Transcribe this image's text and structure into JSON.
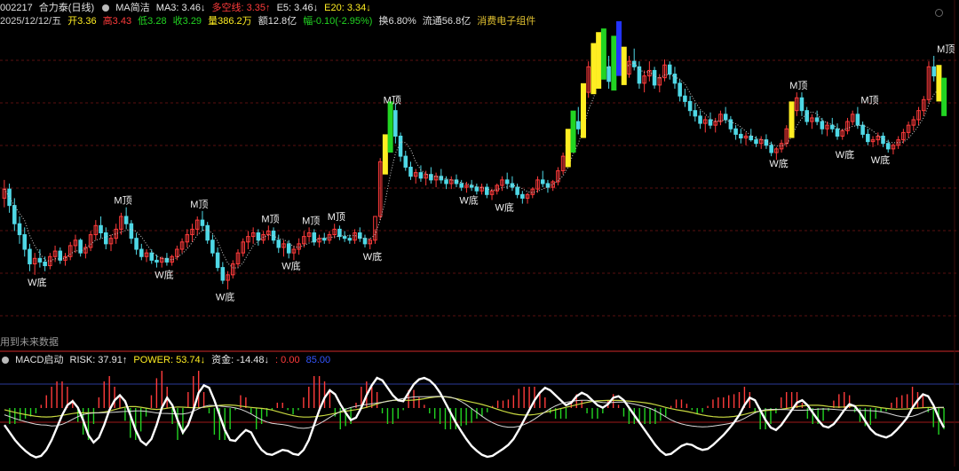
{
  "header": {
    "code": "002217",
    "name": "合力泰(日线)",
    "ma_label": "MA简洁",
    "ma3": "MA3: 3.46↓",
    "duokong": "多空线: 3.35↑",
    "e5": "E5: 3.46↓",
    "e20": "E20: 3.34↓",
    "date": "2025/12/12/五",
    "open": "开3.36",
    "high": "高3.43",
    "low": "低3.28",
    "close": "收3.29",
    "volume": "量386.2万",
    "amount": "额12.8亿",
    "change": "幅-0.10(-2.95%)",
    "turnover": "换6.80%",
    "float_cap": "流通56.8亿",
    "sector": "消费电子组件"
  },
  "colors": {
    "up": "#ff3b3b",
    "down": "#4fd8e6",
    "green_bar": "#22d422",
    "yellow_bar": "#ffee22",
    "blue_bar": "#2233ff",
    "sector": "#e0c030",
    "panel_border": "#8b1a1a"
  },
  "future_note": "用到未来数据",
  "indicator_header": {
    "name": "MACD启动",
    "risk": "RISK: 37.91↑",
    "power": "POWER: 53.74↓",
    "fund": "资金: -14.48↓",
    "v1": ": 0.00",
    "v2": "85.00"
  },
  "chart_data": {
    "type": "candlestick",
    "ylim": [
      2.0,
      3.75
    ],
    "candles": [
      [
        2.8,
        2.9,
        2.75,
        2.85
      ],
      [
        2.85,
        2.88,
        2.72,
        2.76
      ],
      [
        2.76,
        2.8,
        2.62,
        2.66
      ],
      [
        2.66,
        2.7,
        2.55,
        2.6
      ],
      [
        2.6,
        2.64,
        2.48,
        2.52
      ],
      [
        2.52,
        2.55,
        2.4,
        2.44
      ],
      [
        2.44,
        2.5,
        2.38,
        2.47
      ],
      [
        2.47,
        2.52,
        2.42,
        2.45
      ],
      [
        2.45,
        2.48,
        2.4,
        2.43
      ],
      [
        2.43,
        2.5,
        2.41,
        2.48
      ],
      [
        2.48,
        2.54,
        2.45,
        2.51
      ],
      [
        2.51,
        2.53,
        2.44,
        2.46
      ],
      [
        2.46,
        2.5,
        2.43,
        2.48
      ],
      [
        2.48,
        2.56,
        2.46,
        2.54
      ],
      [
        2.54,
        2.6,
        2.5,
        2.57
      ],
      [
        2.57,
        2.58,
        2.48,
        2.5
      ],
      [
        2.5,
        2.55,
        2.47,
        2.53
      ],
      [
        2.53,
        2.62,
        2.51,
        2.6
      ],
      [
        2.6,
        2.68,
        2.57,
        2.65
      ],
      [
        2.65,
        2.7,
        2.58,
        2.61
      ],
      [
        2.61,
        2.64,
        2.52,
        2.55
      ],
      [
        2.55,
        2.6,
        2.51,
        2.58
      ],
      [
        2.58,
        2.66,
        2.55,
        2.63
      ],
      [
        2.63,
        2.72,
        2.6,
        2.7
      ],
      [
        2.7,
        2.75,
        2.63,
        2.66
      ],
      [
        2.66,
        2.68,
        2.55,
        2.58
      ],
      [
        2.58,
        2.61,
        2.49,
        2.52
      ],
      [
        2.52,
        2.55,
        2.46,
        2.48
      ],
      [
        2.48,
        2.52,
        2.45,
        2.5
      ],
      [
        2.5,
        2.52,
        2.44,
        2.46
      ],
      [
        2.46,
        2.49,
        2.42,
        2.45
      ],
      [
        2.45,
        2.48,
        2.42,
        2.47
      ],
      [
        2.47,
        2.5,
        2.43,
        2.45
      ],
      [
        2.45,
        2.49,
        2.43,
        2.48
      ],
      [
        2.48,
        2.54,
        2.46,
        2.52
      ],
      [
        2.52,
        2.58,
        2.5,
        2.56
      ],
      [
        2.56,
        2.63,
        2.53,
        2.6
      ],
      [
        2.6,
        2.66,
        2.56,
        2.63
      ],
      [
        2.63,
        2.7,
        2.6,
        2.68
      ],
      [
        2.68,
        2.73,
        2.62,
        2.65
      ],
      [
        2.65,
        2.67,
        2.55,
        2.57
      ],
      [
        2.57,
        2.6,
        2.48,
        2.5
      ],
      [
        2.5,
        2.53,
        2.4,
        2.42
      ],
      [
        2.42,
        2.45,
        2.33,
        2.35
      ],
      [
        2.35,
        2.4,
        2.3,
        2.38
      ],
      [
        2.38,
        2.46,
        2.36,
        2.44
      ],
      [
        2.44,
        2.52,
        2.42,
        2.5
      ],
      [
        2.5,
        2.58,
        2.48,
        2.56
      ],
      [
        2.56,
        2.62,
        2.52,
        2.59
      ],
      [
        2.59,
        2.64,
        2.55,
        2.61
      ],
      [
        2.61,
        2.63,
        2.54,
        2.57
      ],
      [
        2.57,
        2.62,
        2.55,
        2.6
      ],
      [
        2.6,
        2.65,
        2.57,
        2.62
      ],
      [
        2.62,
        2.64,
        2.55,
        2.57
      ],
      [
        2.57,
        2.6,
        2.5,
        2.53
      ],
      [
        2.53,
        2.57,
        2.48,
        2.55
      ],
      [
        2.55,
        2.57,
        2.47,
        2.5
      ],
      [
        2.5,
        2.54,
        2.46,
        2.52
      ],
      [
        2.52,
        2.58,
        2.49,
        2.55
      ],
      [
        2.55,
        2.62,
        2.53,
        2.59
      ],
      [
        2.59,
        2.64,
        2.56,
        2.61
      ],
      [
        2.61,
        2.63,
        2.54,
        2.56
      ],
      [
        2.56,
        2.6,
        2.53,
        2.58
      ],
      [
        2.58,
        2.61,
        2.55,
        2.57
      ],
      [
        2.57,
        2.62,
        2.55,
        2.6
      ],
      [
        2.6,
        2.66,
        2.58,
        2.63
      ],
      [
        2.63,
        2.65,
        2.57,
        2.59
      ],
      [
        2.59,
        2.62,
        2.56,
        2.58
      ],
      [
        2.58,
        2.6,
        2.55,
        2.57
      ],
      [
        2.57,
        2.63,
        2.55,
        2.61
      ],
      [
        2.61,
        2.64,
        2.56,
        2.58
      ],
      [
        2.58,
        2.6,
        2.53,
        2.55
      ],
      [
        2.55,
        2.58,
        2.52,
        2.57
      ],
      [
        2.57,
        2.63,
        2.55,
        2.7
      ],
      [
        2.7,
        3.02,
        2.68,
        3.0
      ],
      [
        3.0,
        3.12,
        2.96,
        3.1
      ],
      [
        3.1,
        3.3,
        3.08,
        3.28
      ],
      [
        3.28,
        3.32,
        3.1,
        3.14
      ],
      [
        3.14,
        3.16,
        3.0,
        3.03
      ],
      [
        3.03,
        3.06,
        2.95,
        2.97
      ],
      [
        2.97,
        3.0,
        2.9,
        2.92
      ],
      [
        2.92,
        2.96,
        2.88,
        2.94
      ],
      [
        2.94,
        2.98,
        2.89,
        2.91
      ],
      [
        2.91,
        2.95,
        2.87,
        2.93
      ],
      [
        2.93,
        2.97,
        2.88,
        2.9
      ],
      [
        2.9,
        2.94,
        2.86,
        2.92
      ],
      [
        2.92,
        2.96,
        2.88,
        2.9
      ],
      [
        2.9,
        2.92,
        2.85,
        2.88
      ],
      [
        2.88,
        2.92,
        2.85,
        2.9
      ],
      [
        2.9,
        2.93,
        2.86,
        2.88
      ],
      [
        2.88,
        2.9,
        2.84,
        2.86
      ],
      [
        2.86,
        2.89,
        2.83,
        2.87
      ],
      [
        2.87,
        2.9,
        2.84,
        2.86
      ],
      [
        2.86,
        2.88,
        2.82,
        2.84
      ],
      [
        2.84,
        2.88,
        2.82,
        2.86
      ],
      [
        2.86,
        2.88,
        2.8,
        2.82
      ],
      [
        2.82,
        2.85,
        2.79,
        2.84
      ],
      [
        2.84,
        2.88,
        2.82,
        2.87
      ],
      [
        2.87,
        2.92,
        2.84,
        2.9
      ],
      [
        2.9,
        2.94,
        2.85,
        2.88
      ],
      [
        2.88,
        2.92,
        2.84,
        2.86
      ],
      [
        2.86,
        2.88,
        2.8,
        2.82
      ],
      [
        2.82,
        2.84,
        2.77,
        2.8
      ],
      [
        2.8,
        2.83,
        2.77,
        2.82
      ],
      [
        2.82,
        2.86,
        2.8,
        2.85
      ],
      [
        2.85,
        2.92,
        2.83,
        2.9
      ],
      [
        2.9,
        2.95,
        2.86,
        2.88
      ],
      [
        2.88,
        2.9,
        2.83,
        2.86
      ],
      [
        2.86,
        2.9,
        2.84,
        2.89
      ],
      [
        2.89,
        2.97,
        2.87,
        2.95
      ],
      [
        2.95,
        3.05,
        2.93,
        3.03
      ],
      [
        3.03,
        3.15,
        3.0,
        3.12
      ],
      [
        3.12,
        3.25,
        3.08,
        3.22
      ],
      [
        3.22,
        3.3,
        3.15,
        3.18
      ],
      [
        3.18,
        3.4,
        3.16,
        3.38
      ],
      [
        3.38,
        3.55,
        3.35,
        3.52
      ],
      [
        3.52,
        3.62,
        3.4,
        3.45
      ],
      [
        3.45,
        3.68,
        3.43,
        3.66
      ],
      [
        3.66,
        3.7,
        3.48,
        3.52
      ],
      [
        3.52,
        3.58,
        3.4,
        3.44
      ],
      [
        3.44,
        3.66,
        3.42,
        3.62
      ],
      [
        3.62,
        3.74,
        3.5,
        3.55
      ],
      [
        3.55,
        3.6,
        3.45,
        3.48
      ],
      [
        3.48,
        3.58,
        3.46,
        3.55
      ],
      [
        3.55,
        3.62,
        3.5,
        3.52
      ],
      [
        3.52,
        3.55,
        3.4,
        3.43
      ],
      [
        3.43,
        3.5,
        3.38,
        3.47
      ],
      [
        3.47,
        3.55,
        3.44,
        3.5
      ],
      [
        3.5,
        3.52,
        3.4,
        3.42
      ],
      [
        3.42,
        3.48,
        3.38,
        3.46
      ],
      [
        3.46,
        3.56,
        3.44,
        3.53
      ],
      [
        3.53,
        3.55,
        3.45,
        3.48
      ],
      [
        3.48,
        3.52,
        3.4,
        3.43
      ],
      [
        3.43,
        3.45,
        3.33,
        3.36
      ],
      [
        3.36,
        3.4,
        3.3,
        3.33
      ],
      [
        3.33,
        3.36,
        3.25,
        3.28
      ],
      [
        3.28,
        3.32,
        3.22,
        3.25
      ],
      [
        3.25,
        3.28,
        3.18,
        3.21
      ],
      [
        3.21,
        3.25,
        3.16,
        3.23
      ],
      [
        3.23,
        3.27,
        3.18,
        3.2
      ],
      [
        3.2,
        3.24,
        3.16,
        3.22
      ],
      [
        3.22,
        3.28,
        3.2,
        3.26
      ],
      [
        3.26,
        3.3,
        3.21,
        3.23
      ],
      [
        3.23,
        3.25,
        3.16,
        3.18
      ],
      [
        3.18,
        3.2,
        3.12,
        3.15
      ],
      [
        3.15,
        3.18,
        3.1,
        3.13
      ],
      [
        3.13,
        3.16,
        3.09,
        3.14
      ],
      [
        3.14,
        3.18,
        3.11,
        3.12
      ],
      [
        3.12,
        3.14,
        3.08,
        3.1
      ],
      [
        3.1,
        3.14,
        3.07,
        3.12
      ],
      [
        3.12,
        3.15,
        3.07,
        3.09
      ],
      [
        3.09,
        3.11,
        3.03,
        3.05
      ],
      [
        3.05,
        3.08,
        3.01,
        3.07
      ],
      [
        3.07,
        3.12,
        3.05,
        3.1
      ],
      [
        3.1,
        3.2,
        3.08,
        3.18
      ],
      [
        3.18,
        3.3,
        3.16,
        3.28
      ],
      [
        3.28,
        3.38,
        3.25,
        3.35
      ],
      [
        3.35,
        3.38,
        3.25,
        3.28
      ],
      [
        3.28,
        3.3,
        3.2,
        3.22
      ],
      [
        3.22,
        3.26,
        3.18,
        3.24
      ],
      [
        3.24,
        3.28,
        3.2,
        3.22
      ],
      [
        3.22,
        3.24,
        3.15,
        3.18
      ],
      [
        3.18,
        3.22,
        3.14,
        3.2
      ],
      [
        3.2,
        3.24,
        3.16,
        3.18
      ],
      [
        3.18,
        3.21,
        3.12,
        3.14
      ],
      [
        3.14,
        3.18,
        3.12,
        3.17
      ],
      [
        3.17,
        3.24,
        3.15,
        3.22
      ],
      [
        3.22,
        3.28,
        3.2,
        3.26
      ],
      [
        3.26,
        3.3,
        3.18,
        3.2
      ],
      [
        3.2,
        3.22,
        3.13,
        3.15
      ],
      [
        3.15,
        3.18,
        3.09,
        3.11
      ],
      [
        3.11,
        3.14,
        3.08,
        3.12
      ],
      [
        3.12,
        3.16,
        3.09,
        3.14
      ],
      [
        3.14,
        3.16,
        3.08,
        3.1
      ],
      [
        3.1,
        3.12,
        3.05,
        3.07
      ],
      [
        3.07,
        3.1,
        3.04,
        3.09
      ],
      [
        3.09,
        3.14,
        3.07,
        3.12
      ],
      [
        3.12,
        3.18,
        3.1,
        3.16
      ],
      [
        3.16,
        3.22,
        3.13,
        3.2
      ],
      [
        3.2,
        3.25,
        3.17,
        3.23
      ],
      [
        3.23,
        3.3,
        3.2,
        3.28
      ],
      [
        3.28,
        3.36,
        3.25,
        3.34
      ],
      [
        3.34,
        3.55,
        3.32,
        3.52
      ],
      [
        3.52,
        3.58,
        3.44,
        3.47
      ],
      [
        3.47,
        3.5,
        3.36,
        3.39
      ],
      [
        3.39,
        3.43,
        3.28,
        3.29
      ]
    ],
    "annotations": [
      {
        "text": "W底",
        "index": 6,
        "price": 2.38,
        "pos": "below"
      },
      {
        "text": "M顶",
        "index": 23,
        "price": 2.75,
        "pos": "above"
      },
      {
        "text": "W底",
        "index": 31,
        "price": 2.42,
        "pos": "below"
      },
      {
        "text": "M顶",
        "index": 38,
        "price": 2.73,
        "pos": "above"
      },
      {
        "text": "W底",
        "index": 43,
        "price": 2.3,
        "pos": "below"
      },
      {
        "text": "M顶",
        "index": 52,
        "price": 2.65,
        "pos": "above"
      },
      {
        "text": "W底",
        "index": 56,
        "price": 2.47,
        "pos": "below"
      },
      {
        "text": "M顶",
        "index": 60,
        "price": 2.64,
        "pos": "above"
      },
      {
        "text": "M顶",
        "index": 65,
        "price": 2.66,
        "pos": "above"
      },
      {
        "text": "W底",
        "index": 72,
        "price": 2.52,
        "pos": "below"
      },
      {
        "text": "M顶",
        "index": 76,
        "price": 3.3,
        "pos": "above"
      },
      {
        "text": "W底",
        "index": 91,
        "price": 2.83,
        "pos": "below"
      },
      {
        "text": "W底",
        "index": 98,
        "price": 2.79,
        "pos": "below"
      },
      {
        "text": "M顶",
        "index": 156,
        "price": 3.38,
        "pos": "above"
      },
      {
        "text": "W底",
        "index": 152,
        "price": 3.03,
        "pos": "below"
      },
      {
        "text": "M顶",
        "index": 170,
        "price": 3.3,
        "pos": "above"
      },
      {
        "text": "W底",
        "index": 165,
        "price": 3.08,
        "pos": "below"
      },
      {
        "text": "W底",
        "index": 172,
        "price": 3.05,
        "pos": "below"
      },
      {
        "text": "M顶",
        "index": 185,
        "price": 3.58,
        "pos": "above"
      }
    ],
    "signal_bars": [
      {
        "index": 75,
        "color": "yellow"
      },
      {
        "index": 76,
        "color": "green"
      },
      {
        "index": 111,
        "color": "yellow"
      },
      {
        "index": 112,
        "color": "green"
      },
      {
        "index": 114,
        "color": "yellow"
      },
      {
        "index": 116,
        "color": "yellow"
      },
      {
        "index": 117,
        "color": "yellow"
      },
      {
        "index": 118,
        "color": "green"
      },
      {
        "index": 120,
        "color": "green"
      },
      {
        "index": 121,
        "color": "blue"
      },
      {
        "index": 122,
        "color": "yellow"
      },
      {
        "index": 155,
        "color": "yellow"
      },
      {
        "index": 184,
        "color": "yellow"
      },
      {
        "index": 185,
        "color": "green"
      }
    ],
    "indicator": {
      "ylim": [
        -100,
        100
      ],
      "white": [
        -20,
        -35,
        -50,
        -62,
        -72,
        -80,
        -85,
        -82,
        -70,
        -50,
        -25,
        0,
        20,
        28,
        15,
        -10,
        -40,
        -55,
        -45,
        -20,
        10,
        30,
        40,
        28,
        0,
        -30,
        -52,
        -60,
        -48,
        -20,
        15,
        35,
        20,
        -10,
        -35,
        -20,
        10,
        45,
        60,
        55,
        30,
        0,
        -30,
        -50,
        -52,
        -40,
        -30,
        -35,
        -55,
        -70,
        -78,
        -80,
        -75,
        -70,
        -72,
        -78,
        -80,
        -70,
        -50,
        -20,
        10,
        35,
        50,
        42,
        22,
        5,
        -10,
        -5,
        15,
        40,
        60,
        75,
        70,
        55,
        40,
        30,
        28,
        45,
        62,
        72,
        75,
        70,
        60,
        45,
        25,
        5,
        -15,
        -32,
        -48,
        -62,
        -72,
        -80,
        -84,
        -82,
        -75,
        -68,
        -60,
        -48,
        -30,
        -10,
        10,
        30,
        45,
        55,
        50,
        40,
        30,
        20,
        25,
        38,
        45,
        40,
        30,
        20,
        15,
        22,
        35,
        38,
        30,
        15,
        0,
        -15,
        -30,
        -45,
        -60,
        -72,
        -80,
        -78,
        -70,
        -62,
        -58,
        -60,
        -66,
        -70,
        -68,
        -60,
        -50,
        -40,
        -28,
        -15,
        0,
        20,
        35,
        30,
        10,
        -10,
        -25,
        -30,
        -20,
        -5,
        10,
        25,
        30,
        20,
        5,
        -10,
        -22,
        -25,
        -18,
        -5,
        10,
        22,
        18,
        5,
        -12,
        -28,
        -38,
        -42,
        -45,
        -40,
        -30,
        -18,
        -5,
        15,
        30,
        42,
        38,
        20,
        -5,
        -25
      ]
    }
  }
}
